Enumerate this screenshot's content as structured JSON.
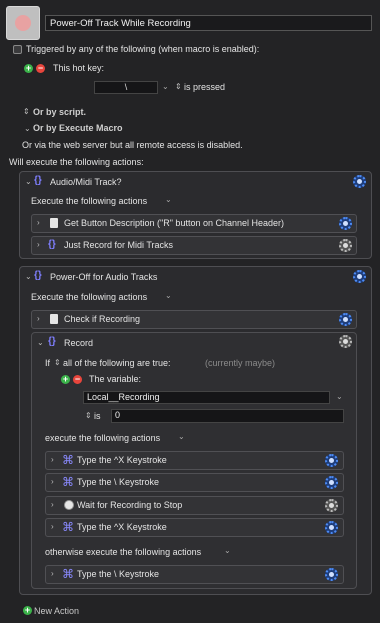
{
  "macro": {
    "name": "Power-Off Track While Recording"
  },
  "triggers": {
    "triggered_by_label": "Triggered by any of the following (when macro is enabled):",
    "hotkey_label": "This hot key:",
    "hotkey_value": "\\",
    "hotkey_condition": "is pressed",
    "or_by_script": "Or by script.",
    "or_by_execute_macro": "Or by Execute Macro",
    "web_server_note": "Or via the web server but all remote access is disabled."
  },
  "actions_header": "Will execute the following actions:",
  "group1": {
    "title": "Audio/Midi Track?",
    "execute_label": "Execute the following actions",
    "actions": [
      {
        "label": "Get Button Description (\"R\" button on Channel Header)",
        "icon": "doc-icon"
      },
      {
        "label": "Just Record for Midi Tracks",
        "icon": "brace-icon"
      }
    ]
  },
  "group2": {
    "title": "Power-Off for Audio Tracks",
    "execute_label": "Execute the following actions",
    "check_label": "Check if Recording",
    "record": {
      "title": "Record",
      "if_label": "If",
      "condition_mode": "all of the following are true:",
      "status": "(currently maybe)",
      "variable_label": "The variable:",
      "variable_name": "Local__Recording",
      "operator": "is",
      "value": "0",
      "then_label": "execute the following actions",
      "then_actions": [
        {
          "label": "Type the ^X Keystroke",
          "icon": "cmd-icon"
        },
        {
          "label": "Type the \\ Keystroke",
          "icon": "cmd-icon"
        },
        {
          "label": "Wait for Recording to Stop",
          "icon": "clock-icon"
        },
        {
          "label": "Type the ^X Keystroke",
          "icon": "cmd-icon"
        }
      ],
      "else_label": "otherwise execute the following actions",
      "else_actions": [
        {
          "label": "Type the \\ Keystroke",
          "icon": "cmd-icon"
        }
      ]
    }
  },
  "new_action_label": "New Action",
  "colors": {
    "accent_blue": "#4d8bf5",
    "plus_green": "#3bb34a",
    "minus_red": "#e8453c"
  }
}
